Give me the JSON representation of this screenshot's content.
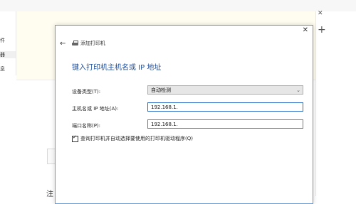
{
  "background": {
    "sidebar_items": [
      "件",
      "器",
      "息"
    ],
    "partial_char": "注"
  },
  "dialog": {
    "title": "添加打印机",
    "heading": "键入打印机主机名或 IP 地址",
    "device_type": {
      "label": "设备类型(T):",
      "value": "自动检测"
    },
    "hostname": {
      "label": "主机名或 IP 地址(A):",
      "value": "192.168.1."
    },
    "port_name": {
      "label": "端口名称(P):",
      "value": "192.168.1."
    },
    "checkbox": {
      "label": "查询打印机并自动选择要使用的打印机驱动程序(Q)",
      "checked": true
    }
  },
  "icons": [
    "close-icon",
    "back-arrow-icon",
    "printer-icon",
    "chevron-down-icon",
    "plus-icon"
  ]
}
